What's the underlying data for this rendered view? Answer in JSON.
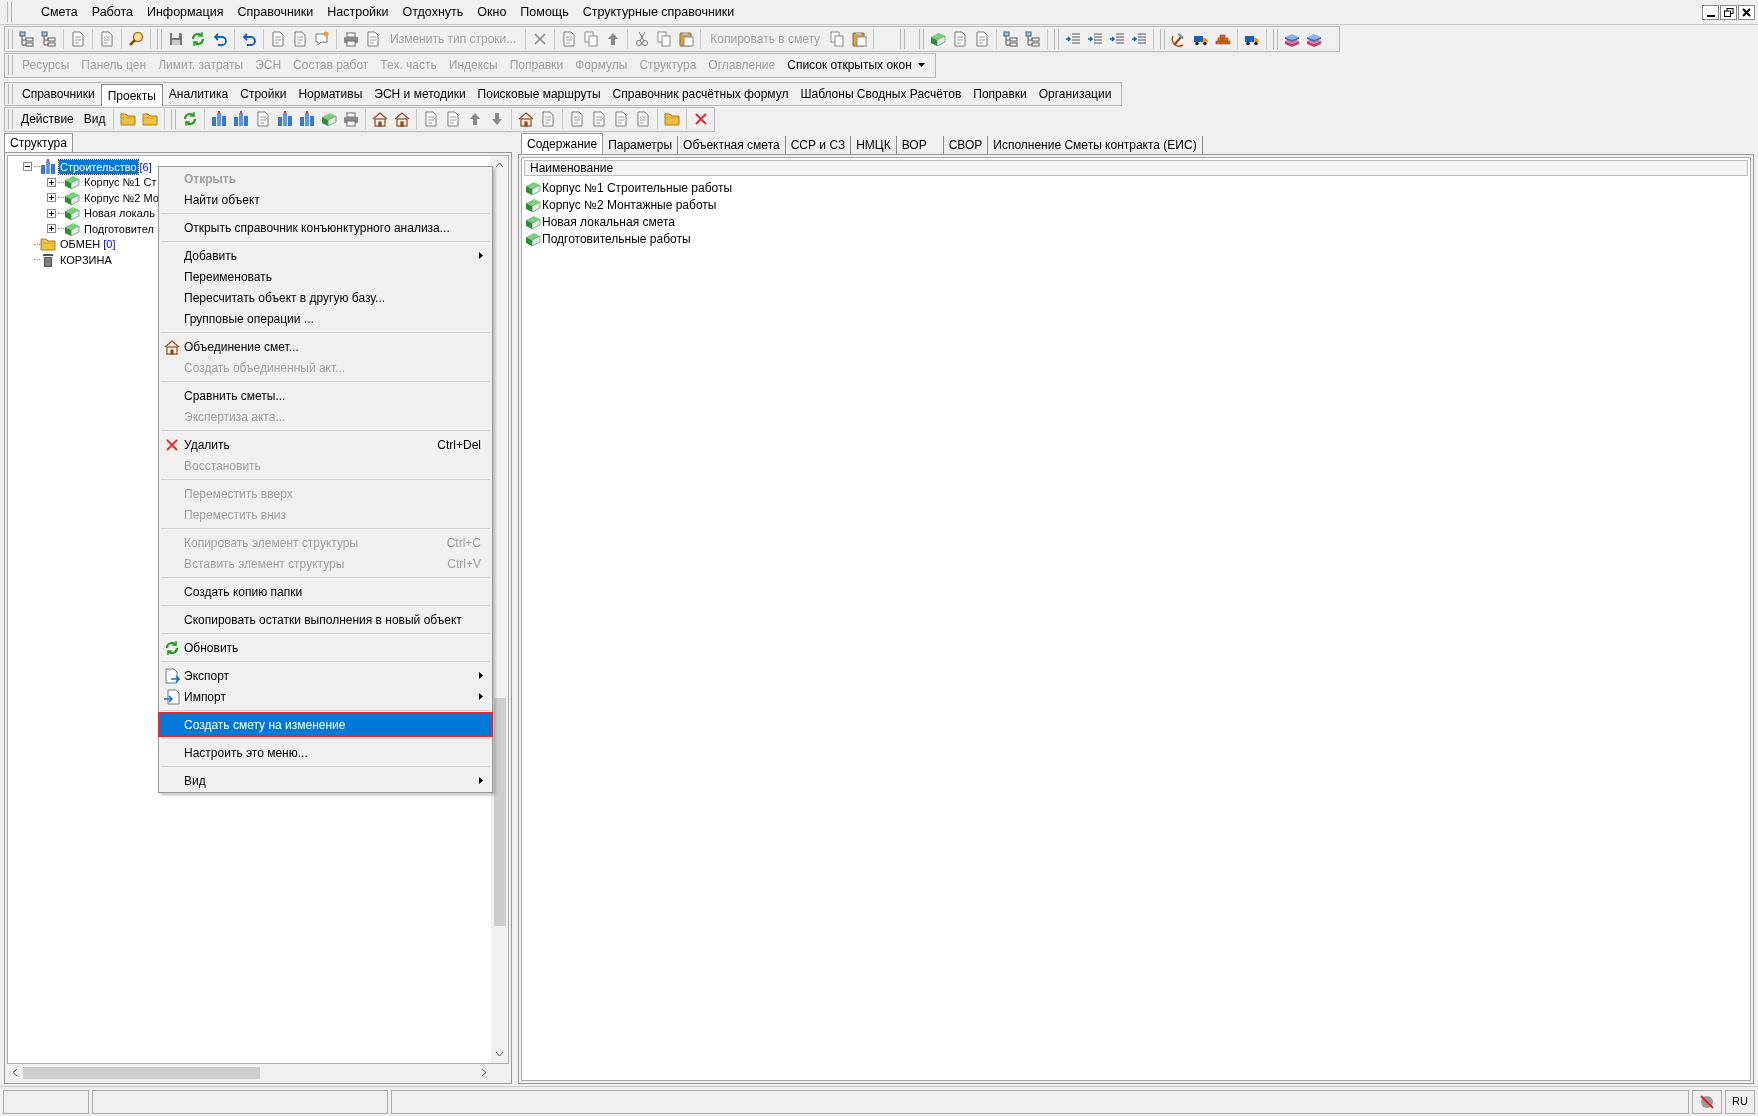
{
  "menu_bar": [
    {
      "label": "Смета"
    },
    {
      "label": "Работа"
    },
    {
      "label": "Информация"
    },
    {
      "label": "Справочники"
    },
    {
      "label": "Настройки"
    },
    {
      "label": "Отдохнуть"
    },
    {
      "label": "Окно"
    },
    {
      "label": "Помощь"
    },
    {
      "label": "Структурные справочники"
    }
  ],
  "main_toolbar": {
    "buttons": [
      {
        "label": "Изменить тип строки...",
        "disabled": true
      },
      {
        "label": "Копировать в смету",
        "disabled": true
      }
    ]
  },
  "window_toolbar": [
    {
      "label": "Ресурсы",
      "disabled": true
    },
    {
      "label": "Панель цен",
      "disabled": true
    },
    {
      "label": "Лимит. затраты",
      "disabled": true
    },
    {
      "label": "ЭСН",
      "disabled": true
    },
    {
      "label": "Состав работ",
      "disabled": true
    },
    {
      "label": "Тех. часть",
      "disabled": true
    },
    {
      "label": "Индексы",
      "disabled": true
    },
    {
      "label": "Поправки",
      "disabled": true
    },
    {
      "label": "Формулы",
      "disabled": true
    },
    {
      "label": "Структура",
      "disabled": true
    },
    {
      "label": "Оглавление",
      "disabled": true
    },
    {
      "label": "Список открытых окон",
      "disabled": false
    }
  ],
  "module_tabs": [
    {
      "label": "Справочники",
      "selected": false
    },
    {
      "label": "Проекты",
      "selected": true
    },
    {
      "label": "Аналитика",
      "selected": false
    },
    {
      "label": "Стройки",
      "selected": false
    },
    {
      "label": "Нормативы",
      "selected": false
    },
    {
      "label": "ЭСН и методики",
      "selected": false
    },
    {
      "label": "Поисковые маршруты",
      "selected": false
    },
    {
      "label": "Справочник расчётных формул",
      "selected": false
    },
    {
      "label": "Шаблоны Сводных Расчётов",
      "selected": false
    },
    {
      "label": "Поправки",
      "selected": false
    },
    {
      "label": "Организации",
      "selected": false
    }
  ],
  "action_toolbar": {
    "menus": [
      "Действие",
      "Вид"
    ]
  },
  "left_panel": {
    "tab": "Структура",
    "tree": [
      {
        "label": "Строительство",
        "count": "[6]",
        "kind": "construction",
        "selected": true,
        "expanded": true,
        "children": [
          {
            "label": "Корпус №1 Ст",
            "kind": "estimate",
            "selected": false,
            "expanded": false
          },
          {
            "label": "Корпус №2 Мо",
            "kind": "estimate",
            "selected": false,
            "expanded": false
          },
          {
            "label": "Новая локаль",
            "kind": "estimate",
            "selected": false,
            "expanded": false
          },
          {
            "label": "Подготовител",
            "kind": "estimate",
            "selected": false,
            "expanded": false
          }
        ]
      },
      {
        "label": "ОБМЕН",
        "count": "[0]",
        "kind": "folder",
        "selected": false
      },
      {
        "label": "КОРЗИНА",
        "kind": "trash",
        "selected": false
      }
    ]
  },
  "context_menu": [
    [
      {
        "label": "Открыть",
        "kind": "plain",
        "disabled": true,
        "bold": true,
        "selected": false
      },
      {
        "label": "Найти объект",
        "kind": "plain",
        "disabled": false,
        "selected": false
      }
    ],
    [
      {
        "label": "Открыть справочник конъюнктурного анализа...",
        "kind": "plain",
        "disabled": false,
        "selected": false
      }
    ],
    [
      {
        "label": "Добавить",
        "kind": "plain",
        "disabled": false,
        "submenu": true,
        "selected": false
      },
      {
        "label": "Переименовать",
        "kind": "plain",
        "disabled": false,
        "selected": false
      },
      {
        "label": "Пересчитать объект в другую базу...",
        "kind": "plain",
        "disabled": false,
        "selected": false
      },
      {
        "label": "Групповые операции ...",
        "kind": "plain",
        "disabled": false,
        "selected": false
      }
    ],
    [
      {
        "label": "Объединение смет...",
        "kind": "merge",
        "disabled": false,
        "selected": false
      },
      {
        "label": "Создать объединенный акт...",
        "kind": "plain",
        "disabled": true,
        "selected": false
      }
    ],
    [
      {
        "label": "Сравнить сметы...",
        "kind": "plain",
        "disabled": false,
        "selected": false
      },
      {
        "label": "Экспертиза акта...",
        "kind": "plain",
        "disabled": true,
        "selected": false
      }
    ],
    [
      {
        "label": "Удалить",
        "kind": "delete",
        "disabled": false,
        "shortcut": "Ctrl+Del",
        "selected": false
      },
      {
        "label": "Восстановить",
        "kind": "plain",
        "disabled": true,
        "selected": false
      }
    ],
    [
      {
        "label": "Переместить вверх",
        "kind": "plain",
        "disabled": true,
        "selected": false
      },
      {
        "label": "Переместить вниз",
        "kind": "plain",
        "disabled": true,
        "selected": false
      }
    ],
    [
      {
        "label": "Копировать элемент структуры",
        "kind": "plain",
        "disabled": true,
        "shortcut": "Ctrl+C",
        "selected": false
      },
      {
        "label": "Вставить элемент структуры",
        "kind": "plain",
        "disabled": true,
        "shortcut": "Ctrl+V",
        "selected": false
      }
    ],
    [
      {
        "label": "Создать копию папки",
        "kind": "plain",
        "disabled": false,
        "selected": false
      }
    ],
    [
      {
        "label": "Скопировать остатки выполнения в новый объект",
        "kind": "plain",
        "disabled": false,
        "selected": false
      }
    ],
    [
      {
        "label": "Обновить",
        "kind": "refresh",
        "disabled": false,
        "selected": false
      }
    ],
    [
      {
        "label": "Экспорт",
        "kind": "export",
        "disabled": false,
        "submenu": true,
        "selected": false
      },
      {
        "label": "Импорт",
        "kind": "import",
        "disabled": false,
        "submenu": true,
        "selected": false
      }
    ],
    [
      {
        "label": "Создать смету на изменение",
        "kind": "plain",
        "disabled": false,
        "selected": true
      }
    ],
    [
      {
        "label": "Настроить это меню...",
        "kind": "plain",
        "disabled": false,
        "selected": false
      }
    ],
    [
      {
        "label": "Вид",
        "kind": "plain",
        "disabled": false,
        "submenu": true,
        "selected": false
      }
    ]
  ],
  "content_panel": {
    "tabs": [
      {
        "label": "Содержание",
        "selected": true
      },
      {
        "label": "Параметры",
        "selected": false
      },
      {
        "label": "Объектная смета",
        "selected": false
      },
      {
        "label": "ССР и СЗ",
        "selected": false
      },
      {
        "label": "НМЦК",
        "selected": false
      },
      {
        "label": "ВОР",
        "selected": false
      },
      {
        "label": "СВОР",
        "selected": false
      },
      {
        "label": "Исполнение Сметы контракта (ЕИС)",
        "selected": false
      }
    ],
    "column": "Наименование",
    "rows": [
      "Корпус №1 Строительные работы",
      "Корпус №2 Монтажные работы",
      "Новая локальная смета",
      "Подготовительные работы"
    ]
  },
  "status_bar": {
    "language": "RU"
  }
}
